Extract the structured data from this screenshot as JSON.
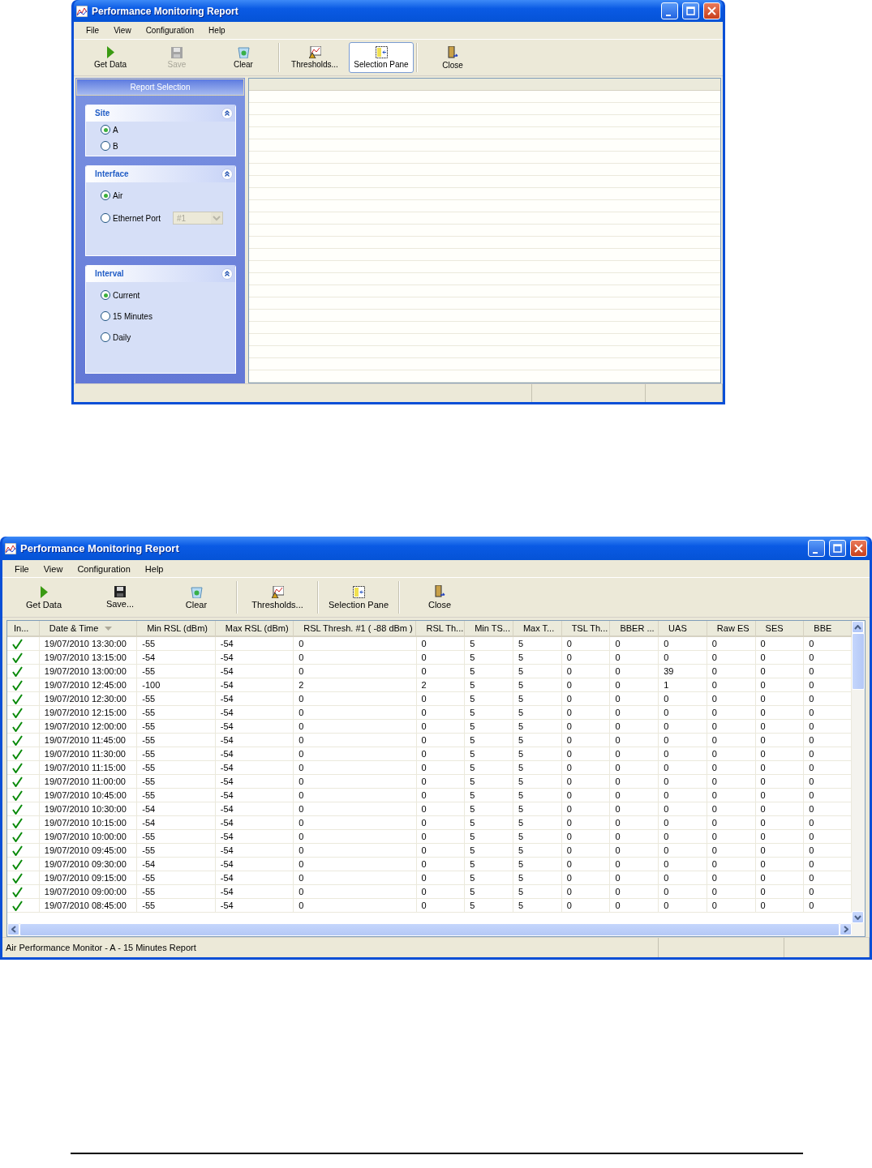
{
  "windows": [
    {
      "kind": "selection",
      "title": "Performance Monitoring Report",
      "menu": [
        "File",
        "View",
        "Configuration",
        "Help"
      ],
      "toolbar": [
        {
          "kind": "play",
          "label": "Get Data",
          "disabled": false,
          "selected": false
        },
        {
          "kind": "floppy",
          "label": "Save",
          "disabled": true,
          "selected": false
        },
        {
          "kind": "clear",
          "label": "Clear",
          "disabled": false,
          "selected": false
        },
        {
          "kind": "separator"
        },
        {
          "kind": "thresholds",
          "label": "Thresholds...",
          "disabled": false,
          "selected": false
        },
        {
          "kind": "pane",
          "label": "Selection Pane",
          "disabled": false,
          "selected": true
        },
        {
          "kind": "separator"
        },
        {
          "kind": "close",
          "label": "Close",
          "disabled": false,
          "selected": false
        }
      ],
      "selection_pane": {
        "title": "Report Selection",
        "groups": [
          {
            "title": "Site",
            "options": [
              {
                "label": "A",
                "selected": true
              },
              {
                "label": "B",
                "selected": false
              }
            ]
          },
          {
            "title": "Interface",
            "options": [
              {
                "label": "Air",
                "selected": true
              },
              {
                "label": "Ethernet Port",
                "selected": false,
                "dropdown": {
                  "value": "#1",
                  "disabled": true
                }
              }
            ]
          },
          {
            "title": "Interval",
            "options": [
              {
                "label": "Current",
                "selected": true
              },
              {
                "label": "15 Minutes",
                "selected": false
              },
              {
                "label": "Daily",
                "selected": false
              }
            ]
          }
        ]
      }
    },
    {
      "kind": "report",
      "title": "Performance Monitoring Report",
      "menu": [
        "File",
        "View",
        "Configuration",
        "Help"
      ],
      "toolbar": [
        {
          "kind": "play",
          "label": "Get Data",
          "disabled": false,
          "selected": false
        },
        {
          "kind": "floppy",
          "label": "Save...",
          "disabled": false,
          "selected": false
        },
        {
          "kind": "clear",
          "label": "Clear",
          "disabled": false,
          "selected": false
        },
        {
          "kind": "separator"
        },
        {
          "kind": "thresholds",
          "label": "Thresholds...",
          "disabled": false,
          "selected": false
        },
        {
          "kind": "separator"
        },
        {
          "kind": "pane",
          "label": "Selection Pane",
          "disabled": false,
          "selected": false
        },
        {
          "kind": "separator"
        },
        {
          "kind": "close",
          "label": "Close",
          "disabled": false,
          "selected": false
        }
      ],
      "table": {
        "columns": [
          {
            "label": "In...",
            "sorted": false
          },
          {
            "label": "Date & Time",
            "sorted": true
          },
          {
            "label": "Min RSL (dBm)",
            "sorted": false
          },
          {
            "label": "Max RSL (dBm)",
            "sorted": false
          },
          {
            "label": "RSL Thresh. #1 ( -88 dBm )",
            "sorted": false
          },
          {
            "label": "RSL Th...",
            "sorted": false
          },
          {
            "label": "Min TS...",
            "sorted": false
          },
          {
            "label": "Max T...",
            "sorted": false
          },
          {
            "label": "TSL Th...",
            "sorted": false
          },
          {
            "label": "BBER ...",
            "sorted": false
          },
          {
            "label": "UAS",
            "sorted": false
          },
          {
            "label": "Raw ES",
            "sorted": false
          },
          {
            "label": "SES",
            "sorted": false
          },
          {
            "label": "BBE",
            "sorted": false
          }
        ],
        "rows": [
          {
            "ok": true,
            "cells": [
              "",
              "19/07/2010 13:30:00",
              "-55",
              "-54",
              "0",
              "0",
              "5",
              "5",
              "0",
              "0",
              "0",
              "0",
              "0",
              "0"
            ]
          },
          {
            "ok": true,
            "cells": [
              "",
              "19/07/2010 13:15:00",
              "-54",
              "-54",
              "0",
              "0",
              "5",
              "5",
              "0",
              "0",
              "0",
              "0",
              "0",
              "0"
            ]
          },
          {
            "ok": true,
            "cells": [
              "",
              "19/07/2010 13:00:00",
              "-55",
              "-54",
              "0",
              "0",
              "5",
              "5",
              "0",
              "0",
              "39",
              "0",
              "0",
              "0"
            ]
          },
          {
            "ok": true,
            "cells": [
              "",
              "19/07/2010 12:45:00",
              "-100",
              "-54",
              "2",
              "2",
              "5",
              "5",
              "0",
              "0",
              "1",
              "0",
              "0",
              "0"
            ]
          },
          {
            "ok": true,
            "cells": [
              "",
              "19/07/2010 12:30:00",
              "-55",
              "-54",
              "0",
              "0",
              "5",
              "5",
              "0",
              "0",
              "0",
              "0",
              "0",
              "0"
            ]
          },
          {
            "ok": true,
            "cells": [
              "",
              "19/07/2010 12:15:00",
              "-55",
              "-54",
              "0",
              "0",
              "5",
              "5",
              "0",
              "0",
              "0",
              "0",
              "0",
              "0"
            ]
          },
          {
            "ok": true,
            "cells": [
              "",
              "19/07/2010 12:00:00",
              "-55",
              "-54",
              "0",
              "0",
              "5",
              "5",
              "0",
              "0",
              "0",
              "0",
              "0",
              "0"
            ]
          },
          {
            "ok": true,
            "cells": [
              "",
              "19/07/2010 11:45:00",
              "-55",
              "-54",
              "0",
              "0",
              "5",
              "5",
              "0",
              "0",
              "0",
              "0",
              "0",
              "0"
            ]
          },
          {
            "ok": true,
            "cells": [
              "",
              "19/07/2010 11:30:00",
              "-55",
              "-54",
              "0",
              "0",
              "5",
              "5",
              "0",
              "0",
              "0",
              "0",
              "0",
              "0"
            ]
          },
          {
            "ok": true,
            "cells": [
              "",
              "19/07/2010 11:15:00",
              "-55",
              "-54",
              "0",
              "0",
              "5",
              "5",
              "0",
              "0",
              "0",
              "0",
              "0",
              "0"
            ]
          },
          {
            "ok": true,
            "cells": [
              "",
              "19/07/2010 11:00:00",
              "-55",
              "-54",
              "0",
              "0",
              "5",
              "5",
              "0",
              "0",
              "0",
              "0",
              "0",
              "0"
            ]
          },
          {
            "ok": true,
            "cells": [
              "",
              "19/07/2010 10:45:00",
              "-55",
              "-54",
              "0",
              "0",
              "5",
              "5",
              "0",
              "0",
              "0",
              "0",
              "0",
              "0"
            ]
          },
          {
            "ok": true,
            "cells": [
              "",
              "19/07/2010 10:30:00",
              "-54",
              "-54",
              "0",
              "0",
              "5",
              "5",
              "0",
              "0",
              "0",
              "0",
              "0",
              "0"
            ]
          },
          {
            "ok": true,
            "cells": [
              "",
              "19/07/2010 10:15:00",
              "-54",
              "-54",
              "0",
              "0",
              "5",
              "5",
              "0",
              "0",
              "0",
              "0",
              "0",
              "0"
            ]
          },
          {
            "ok": true,
            "cells": [
              "",
              "19/07/2010 10:00:00",
              "-55",
              "-54",
              "0",
              "0",
              "5",
              "5",
              "0",
              "0",
              "0",
              "0",
              "0",
              "0"
            ]
          },
          {
            "ok": true,
            "cells": [
              "",
              "19/07/2010 09:45:00",
              "-55",
              "-54",
              "0",
              "0",
              "5",
              "5",
              "0",
              "0",
              "0",
              "0",
              "0",
              "0"
            ]
          },
          {
            "ok": true,
            "cells": [
              "",
              "19/07/2010 09:30:00",
              "-54",
              "-54",
              "0",
              "0",
              "5",
              "5",
              "0",
              "0",
              "0",
              "0",
              "0",
              "0"
            ]
          },
          {
            "ok": true,
            "cells": [
              "",
              "19/07/2010 09:15:00",
              "-55",
              "-54",
              "0",
              "0",
              "5",
              "5",
              "0",
              "0",
              "0",
              "0",
              "0",
              "0"
            ]
          },
          {
            "ok": true,
            "cells": [
              "",
              "19/07/2010 09:00:00",
              "-55",
              "-54",
              "0",
              "0",
              "5",
              "5",
              "0",
              "0",
              "0",
              "0",
              "0",
              "0"
            ]
          },
          {
            "ok": true,
            "cells": [
              "",
              "19/07/2010 08:45:00",
              "-55",
              "-54",
              "0",
              "0",
              "5",
              "5",
              "0",
              "0",
              "0",
              "0",
              "0",
              "0"
            ]
          }
        ]
      },
      "status_bar": "Air Performance Monitor - A - 15 Minutes Report"
    }
  ]
}
